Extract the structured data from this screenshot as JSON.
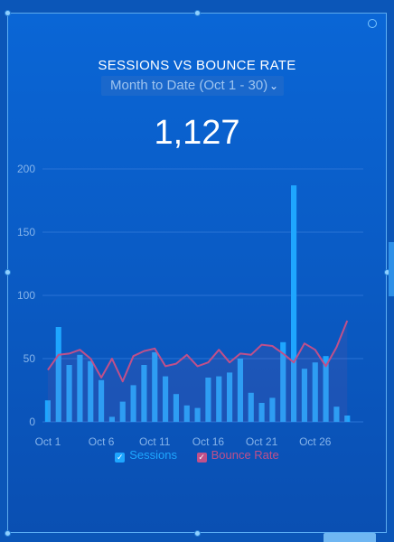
{
  "widget": {
    "title": "SESSIONS VS BOUNCE RATE",
    "period_label": "Month to Date (Oct 1 - 30)",
    "total": "1,127"
  },
  "legend": {
    "sessions_label": "Sessions",
    "bounce_label": "Bounce Rate"
  },
  "colors": {
    "sessions": "#1ea6ff",
    "bounce": "#c0508a",
    "gridline": "#2a73d6",
    "axis_text": "#86b4ea"
  },
  "chart_data": {
    "type": "bar",
    "title": "SESSIONS VS BOUNCE RATE",
    "x_tick_labels": [
      "Oct 1",
      "Oct 6",
      "Oct 11",
      "Oct 16",
      "Oct 21",
      "Oct 26"
    ],
    "y_ticks": [
      0,
      50,
      100,
      150,
      200
    ],
    "ylim": [
      0,
      200
    ],
    "grid": true,
    "legend_placement": "bottom-center",
    "categories": [
      "Oct 1",
      "Oct 2",
      "Oct 3",
      "Oct 4",
      "Oct 5",
      "Oct 6",
      "Oct 7",
      "Oct 8",
      "Oct 9",
      "Oct 10",
      "Oct 11",
      "Oct 12",
      "Oct 13",
      "Oct 14",
      "Oct 15",
      "Oct 16",
      "Oct 17",
      "Oct 18",
      "Oct 19",
      "Oct 20",
      "Oct 21",
      "Oct 22",
      "Oct 23",
      "Oct 24",
      "Oct 25",
      "Oct 26",
      "Oct 27",
      "Oct 28",
      "Oct 29",
      "Oct 30"
    ],
    "series": [
      {
        "name": "Sessions",
        "type": "bar",
        "values": [
          17,
          75,
          45,
          53,
          48,
          33,
          4,
          16,
          29,
          45,
          55,
          36,
          22,
          13,
          11,
          35,
          36,
          39,
          50,
          23,
          15,
          19,
          63,
          187,
          42,
          47,
          52,
          12,
          5
        ]
      },
      {
        "name": "Bounce Rate",
        "type": "line",
        "values": [
          41,
          53,
          54,
          57,
          50,
          35,
          50,
          32,
          52,
          56,
          58,
          44,
          46,
          53,
          44,
          47,
          57,
          47,
          54,
          53,
          61,
          60,
          54,
          47,
          62,
          57,
          44,
          59,
          80
        ]
      }
    ]
  }
}
